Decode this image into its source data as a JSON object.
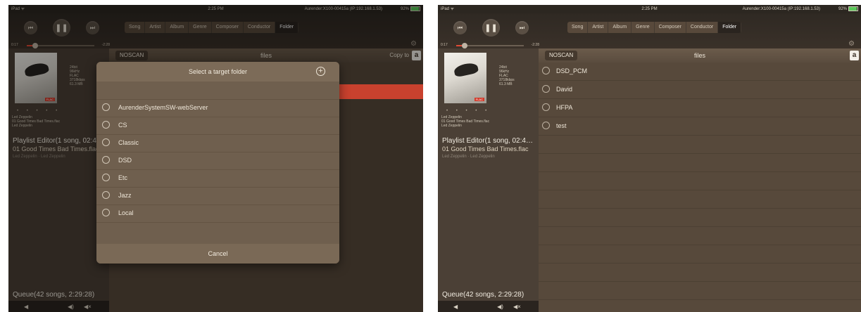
{
  "status": {
    "carrier": "iPad ᯤ",
    "time": "2:25 PM",
    "host": "Aurender:X100-00415a (IP:192.168.1.53)",
    "battery": "92%"
  },
  "player": {
    "elapsed": "0:17",
    "remaining": "-2:28",
    "progress_fraction": 0.12,
    "prev_icon": "prev-track-icon",
    "pause_icon": "pause-icon",
    "next_icon": "next-track-icon"
  },
  "tabs": [
    "Song",
    "Artist",
    "Album",
    "Genre",
    "Composer",
    "Conductor",
    "Folder"
  ],
  "active_tab": "Folder",
  "now_playing": {
    "meta": [
      "24bit",
      "96kHz",
      "FLAC",
      "3718kbps",
      "61.3 MB"
    ],
    "format_badge": "FLAC",
    "stars": "• • • • •",
    "info_line1": "Led Zeppelin",
    "info_line2": "01 Good Times Bad Times.flac",
    "info_line3": "Led Zeppelin"
  },
  "playlist": {
    "title": "Playlist Editor(1 song, 02:4…",
    "track": "01 Good Times Bad Times.flac",
    "artist": "Led Zeppelin · Led Zeppelin"
  },
  "queue": {
    "label": "Queue(42 songs, 2:29:28)"
  },
  "volume": {
    "mute": "◀",
    "down": "◀)",
    "up": "◀×"
  },
  "nav": {
    "back": "NOSCAN",
    "title": "files",
    "copy_to": "Copy to",
    "a_button": "a"
  },
  "modal": {
    "title": "Select a target folder",
    "folders": [
      "AurenderSystemSW-webServer",
      "CS",
      "Classic",
      "DSD",
      "Etc",
      "Jazz",
      "Local"
    ],
    "cancel": "Cancel"
  },
  "files": [
    "DSD_PCM",
    "David",
    "HFPA",
    "test"
  ]
}
